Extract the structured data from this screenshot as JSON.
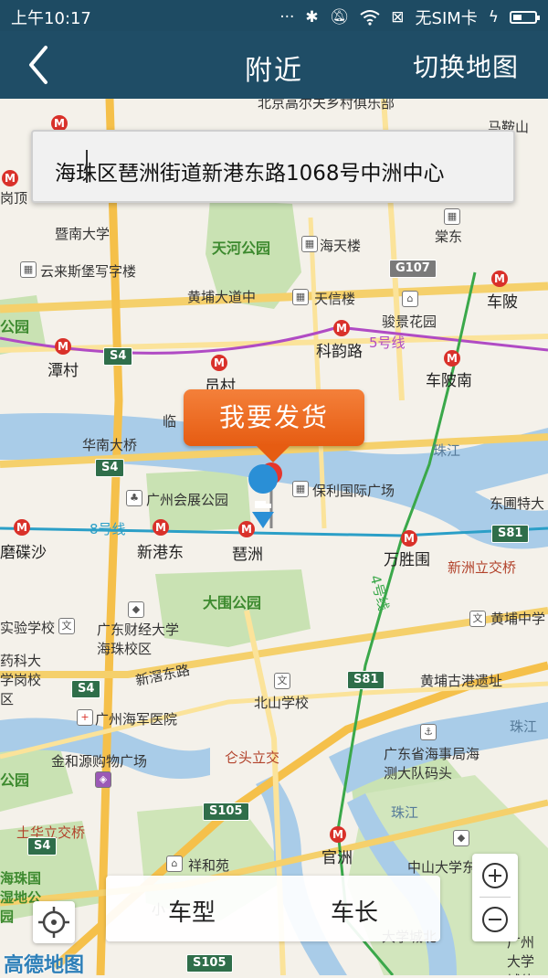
{
  "status_bar": {
    "time": "上午10:17",
    "sim": "无SIM卡"
  },
  "header": {
    "back_icon": "chevron-left-icon",
    "title": "附近",
    "switch_label": "切换地图"
  },
  "address": {
    "value": "海珠区琶洲街道新港东路1068号中洲中心"
  },
  "bubble": {
    "label": "我要发货"
  },
  "bottom_bar": {
    "option_1": "车型",
    "option_2": "车长"
  },
  "map": {
    "brand": "高德地图",
    "labels": {
      "nanfang_tou": "北京高尔夫乡村俱乐部",
      "maaoshan": "马鞍山",
      "gangding": "岗顶",
      "jinan_univ": "暨南大学",
      "tianhe_park": "天河公园",
      "haitian": "海天楼",
      "tangdong": "棠东",
      "yunlai": "云来斯堡写字楼",
      "g107": "G107",
      "huangpu_road": "黄埔大道中",
      "tianxin": "天信楼",
      "chebei": "车陂",
      "junfeng": "骏景花园",
      "park_left": "公园",
      "keyun_road": "科韵路",
      "line5": "5号线",
      "tancun": "潭村",
      "s4_top": "S4",
      "yuancun": "员村",
      "chebeinan": "车陂南",
      "linjiang": "临",
      "huanan_bridge": "华南大桥",
      "zhujiang_1": "珠江",
      "s4_mid": "S4",
      "baoli": "保利国际广场",
      "huizhan_park": "广州会展公园",
      "dongpu_bridge": "东圃特大",
      "line8": "8号线",
      "tiechongsha": "磨碟沙",
      "xingangdong": "新港东",
      "pazhou": "琶洲",
      "wansheng": "万胜围",
      "s81_right": "S81",
      "xinzhou_interchange": "新洲立交桥",
      "dawei_park": "大围公园",
      "line4": "4号线",
      "shiyan_school": "实验学校",
      "caijing": "广东财经大学海珠校区",
      "huangpu_middle": "黄埔中学",
      "yaoke": "药科大学岗校区",
      "xinjiao_road": "新滘东路",
      "s4_low": "S4",
      "s81_mid": "S81",
      "huangpu_gugang": "黄埔古港遗址",
      "haijun": "广州海军医院",
      "beishan": "北山学校",
      "zhujiang_2": "珠江",
      "jinheyuan": "金和源购物广场",
      "cangtou": "仑头立交",
      "haishi": "广东省海事局海测大队码头",
      "park_low": "公园",
      "s105_mid": "S105",
      "zhujiang_3": "珠江",
      "tuhua": "土华立交桥",
      "s4_bottom": "S4",
      "hezhu_park": "海珠国湿地公园",
      "xiangheyuan": "祥和苑",
      "guanzhou": "官洲",
      "zhongshan": "中山大学东校区",
      "daxuecheng": "大学城北",
      "xiao": "小",
      "guangzhou_city": "广州大学城体育",
      "s105_bottom": "S105"
    }
  }
}
